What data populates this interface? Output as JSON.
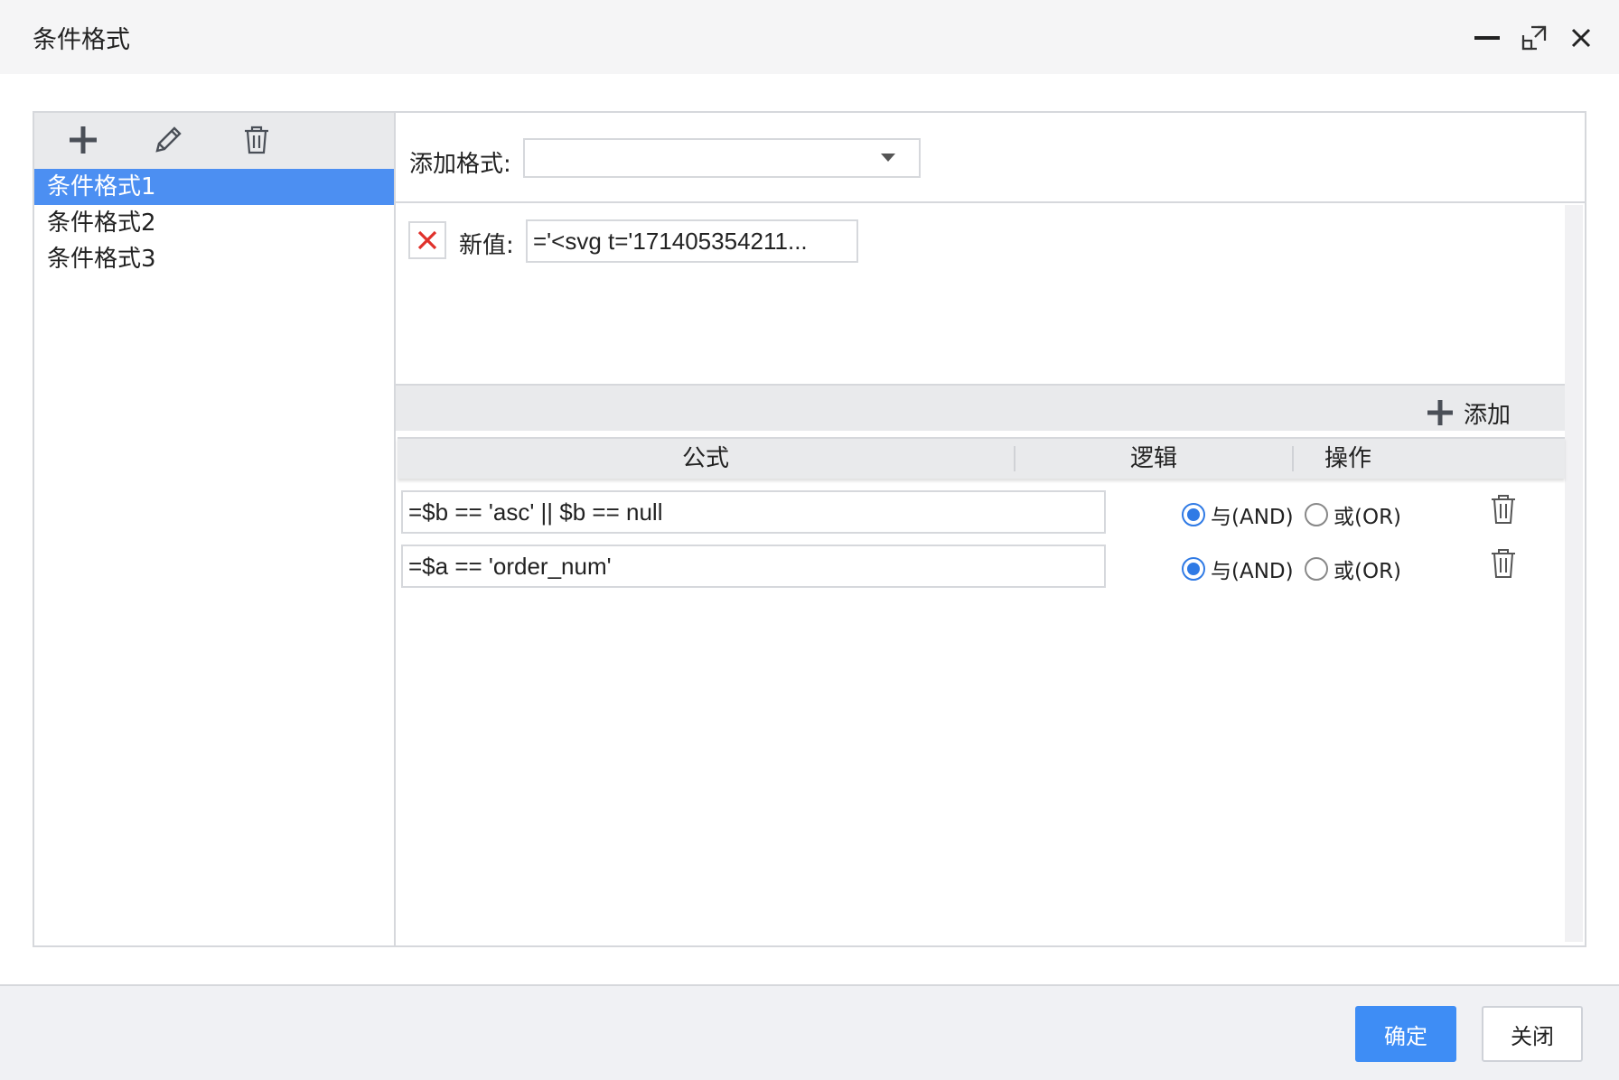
{
  "window": {
    "title": "条件格式",
    "icons": [
      "minimize-icon",
      "maximize-icon",
      "close-icon"
    ]
  },
  "left_panel": {
    "toolbar_icons": [
      "plus-icon",
      "pencil-icon",
      "trash-icon"
    ],
    "items": [
      {
        "label": "条件格式1",
        "selected": true
      },
      {
        "label": "条件格式2",
        "selected": false
      },
      {
        "label": "条件格式3",
        "selected": false
      }
    ]
  },
  "format": {
    "add_label": "添加格式:",
    "select_value": "",
    "new_value_label": "新值:",
    "new_value": "='<svg t='171405354211..."
  },
  "conditions": {
    "add_label": "添加",
    "columns": {
      "formula": "公式",
      "logic": "逻辑",
      "action": "操作"
    },
    "and_label": "与(AND)",
    "or_label": "或(OR)",
    "rows": [
      {
        "formula": "=$b == 'asc' || $b == null",
        "logic": "AND"
      },
      {
        "formula": "=$a == 'order_num'",
        "logic": "AND"
      }
    ]
  },
  "footer": {
    "ok_label": "确定",
    "close_label": "关闭"
  },
  "colors": {
    "accent": "#3e8df5",
    "selected_item": "#4c8ff2",
    "delete_red": "#e0312b"
  }
}
